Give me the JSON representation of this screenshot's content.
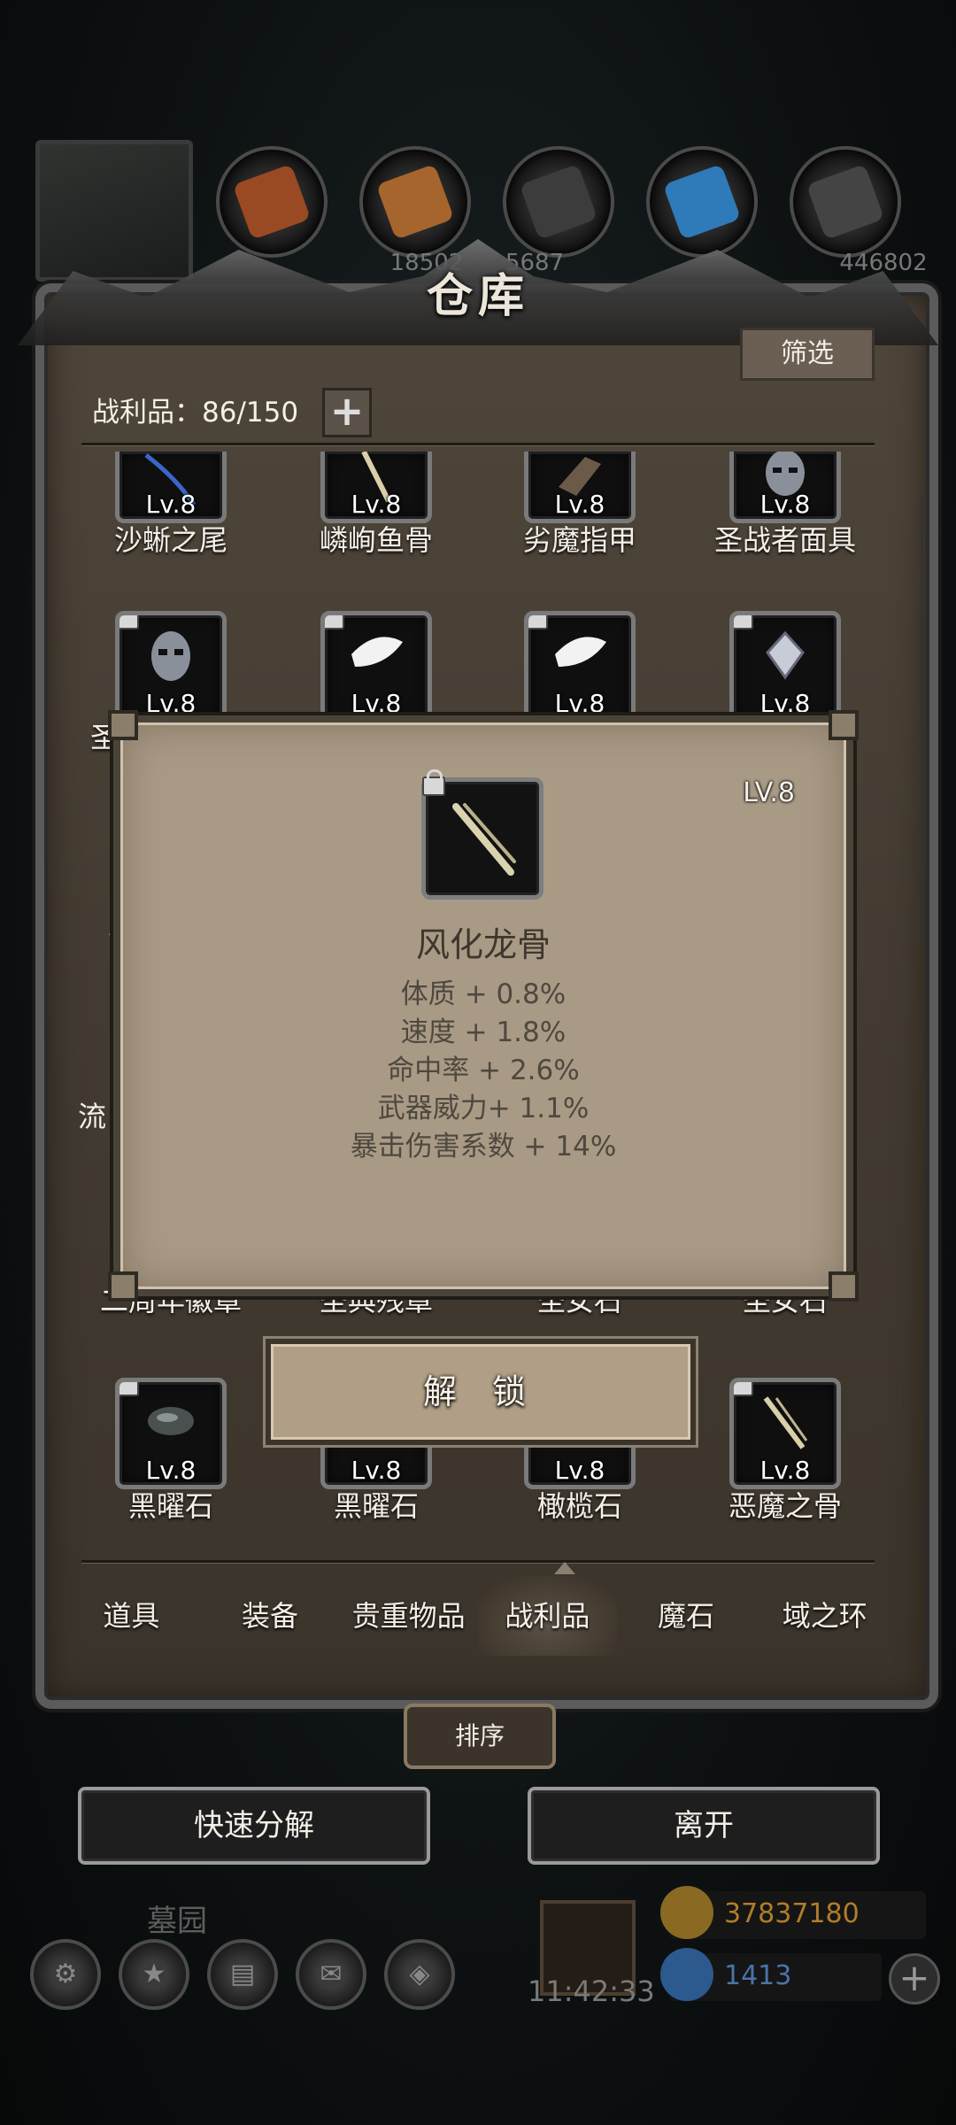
{
  "resources": {
    "values": [
      "",
      "18502",
      "5687",
      "",
      "446802"
    ]
  },
  "panel": {
    "title": "仓库",
    "filter_label": "筛选",
    "trophy_count_label": "战利品：86/150",
    "expand_label": "+"
  },
  "items": [
    {
      "name": "沙蜥之尾",
      "level": "Lv.8",
      "icon": "tail-icon",
      "locked": false
    },
    {
      "name": "嶙峋鱼骨",
      "level": "Lv.8",
      "icon": "bone-icon",
      "locked": false
    },
    {
      "name": "劣魔指甲",
      "level": "Lv.8",
      "icon": "claw-icon",
      "locked": false
    },
    {
      "name": "圣战者面具",
      "level": "Lv.8",
      "icon": "mask-icon",
      "locked": false
    },
    {
      "name": "圣",
      "level": "Lv.8",
      "icon": "mask-icon",
      "locked": true
    },
    {
      "name": "",
      "level": "Lv.8",
      "icon": "feather-icon",
      "locked": true
    },
    {
      "name": "",
      "level": "Lv.8",
      "icon": "feather-icon",
      "locked": true
    },
    {
      "name": "",
      "level": "Lv.8",
      "icon": "badge-icon",
      "locked": true
    },
    {
      "name": "二周年徽章",
      "level": "",
      "icon": "",
      "locked": false
    },
    {
      "name": "圣典残章",
      "level": "",
      "icon": "",
      "locked": false
    },
    {
      "name": "圣女石",
      "level": "",
      "icon": "",
      "locked": false
    },
    {
      "name": "圣女石",
      "level": "",
      "icon": "",
      "locked": false
    },
    {
      "name": "黑曜石",
      "level": "Lv.8",
      "icon": "obsidian-icon",
      "locked": true
    },
    {
      "name": "黑曜石",
      "level": "Lv.8",
      "icon": "obsidian-icon",
      "locked": false
    },
    {
      "name": "橄榄石",
      "level": "Lv.8",
      "icon": "olivine-icon",
      "locked": false
    },
    {
      "name": "恶魔之骨",
      "level": "Lv.8",
      "icon": "bone-icon",
      "locked": true
    }
  ],
  "partial_left_labels": [
    "流",
    "广"
  ],
  "tabs": [
    "道具",
    "装备",
    "贵重物品",
    "战利品",
    "魔石",
    "域之环"
  ],
  "active_tab": "战利品",
  "sort_label": "排序",
  "quick_decompose_label": "快速分解",
  "leave_label": "离开",
  "popup": {
    "level": "LV.8",
    "name": "风化龙骨",
    "icon": "dragon-bone-icon",
    "stats": [
      "体质 + 0.8%",
      "速度 + 1.8%",
      "命中率 + 2.6%",
      "武器威力+ 1.1%",
      "暴击伤害系数 + 14%"
    ],
    "unlock_label": "解 锁"
  },
  "hud": {
    "location": "墓园",
    "time": "11:42:33",
    "gold": "37837180",
    "gems": "1413",
    "add_label": "+"
  },
  "colors": {
    "panel_bg": "#4a4137",
    "popup_bg": "#a99a86",
    "gold_text": "#b07d2a",
    "gem_text": "#4a73a8"
  }
}
